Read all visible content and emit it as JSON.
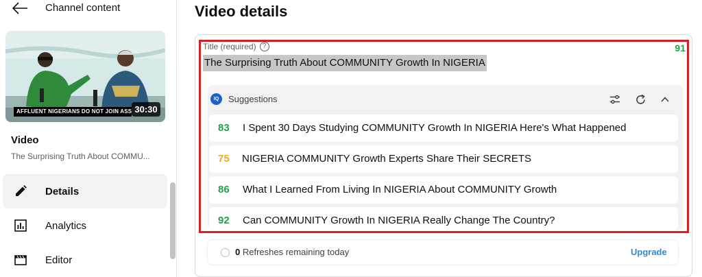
{
  "sidebar": {
    "title": "Channel content",
    "thumbnail": {
      "caption": "AFFLUENT NIGERIANS DO NOT JOIN ASSOC",
      "duration": "30:30"
    },
    "video_label": "Video",
    "video_title": "The Surprising Truth About COMMU...",
    "nav": [
      {
        "label": "Details",
        "icon": "pencil-icon",
        "active": true
      },
      {
        "label": "Analytics",
        "icon": "analytics-icon"
      },
      {
        "label": "Editor",
        "icon": "editor-icon"
      }
    ]
  },
  "main": {
    "page_title": "Video details",
    "title_field": {
      "label": "Title (required)",
      "help": "?",
      "value": "The Surprising Truth About COMMUNITY Growth In NIGERIA",
      "score": "91"
    },
    "suggestions": {
      "logo_text": "IQ",
      "label": "Suggestions",
      "items": [
        {
          "score": "83",
          "text": "I Spent 30 Days Studying COMMUNITY Growth In NIGERIA Here's What Happened",
          "color": "#1ea446"
        },
        {
          "score": "75",
          "text": "NIGERIA COMMUNITY Growth Experts Share Their SECRETS",
          "color": "#f0ad1c"
        },
        {
          "score": "86",
          "text": "What I Learned From Living In NIGERIA About COMMUNITY Growth",
          "color": "#1ea446"
        },
        {
          "score": "92",
          "text": "Can COMMUNITY Growth In NIGERIA Really Change The Country?",
          "color": "#1ea446"
        }
      ]
    },
    "refresh": {
      "count": "0",
      "text": " Refreshes remaining today",
      "upgrade": "Upgrade"
    }
  },
  "colors": {
    "highlight": "#d62027",
    "score_green": "#1ea446",
    "score_yellow": "#f0ad1c",
    "link_blue": "#2b8cd6"
  }
}
